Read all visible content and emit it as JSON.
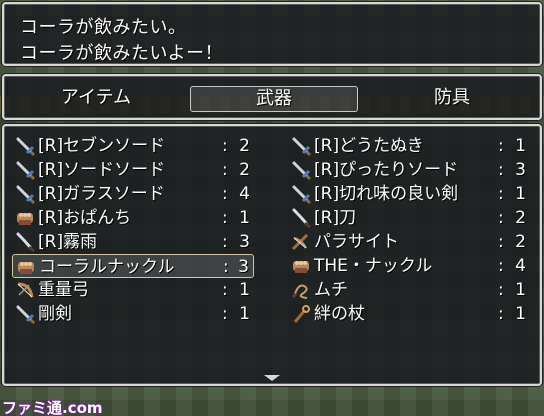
{
  "message": {
    "line1": "コーラが飲みたい。",
    "line2": "コーラが飲みたいよー！"
  },
  "tabs": [
    {
      "label": "アイテム",
      "selected": false
    },
    {
      "label": "武器",
      "selected": true
    },
    {
      "label": "防具",
      "selected": false
    }
  ],
  "items": [
    {
      "name": "[R]セブンソード",
      "colon": ":",
      "qty": "2",
      "icon": "sword-icon",
      "selected": false
    },
    {
      "name": "[R]どうたぬき",
      "colon": ":",
      "qty": "1",
      "icon": "sword-icon",
      "selected": false
    },
    {
      "name": "[R]ソードソード",
      "colon": ":",
      "qty": "2",
      "icon": "sword-icon",
      "selected": false
    },
    {
      "name": "[R]ぴったりソード",
      "colon": ":",
      "qty": "3",
      "icon": "sword-icon",
      "selected": false
    },
    {
      "name": "[R]ガラスソード",
      "colon": ":",
      "qty": "4",
      "icon": "sword-icon",
      "selected": false
    },
    {
      "name": "[R]切れ味の良い剣",
      "colon": ":",
      "qty": "1",
      "icon": "sword-icon",
      "selected": false
    },
    {
      "name": "[R]おぱんち",
      "colon": ":",
      "qty": "1",
      "icon": "knuckle-icon",
      "selected": false
    },
    {
      "name": "[R]刀",
      "colon": ":",
      "qty": "2",
      "icon": "katana-icon",
      "selected": false
    },
    {
      "name": "[R]霧雨",
      "colon": ":",
      "qty": "3",
      "icon": "katana-icon",
      "selected": false
    },
    {
      "name": "パラサイト",
      "colon": ":",
      "qty": "2",
      "icon": "crossbow-icon",
      "selected": false
    },
    {
      "name": "コーラルナックル",
      "colon": ":",
      "qty": "3",
      "icon": "knuckle-icon",
      "selected": true
    },
    {
      "name": "THE・ナックル",
      "colon": ":",
      "qty": "4",
      "icon": "knuckle-icon",
      "selected": false
    },
    {
      "name": "重量弓",
      "colon": ":",
      "qty": "1",
      "icon": "bow-icon",
      "selected": false
    },
    {
      "name": "ムチ",
      "colon": ":",
      "qty": "1",
      "icon": "whip-icon",
      "selected": false
    },
    {
      "name": "剛剣",
      "colon": ":",
      "qty": "1",
      "icon": "sword-icon",
      "selected": false
    },
    {
      "name": "絆の杖",
      "colon": ":",
      "qty": "1",
      "icon": "staff-icon",
      "selected": false
    }
  ],
  "watermark": "ファミ通.com"
}
